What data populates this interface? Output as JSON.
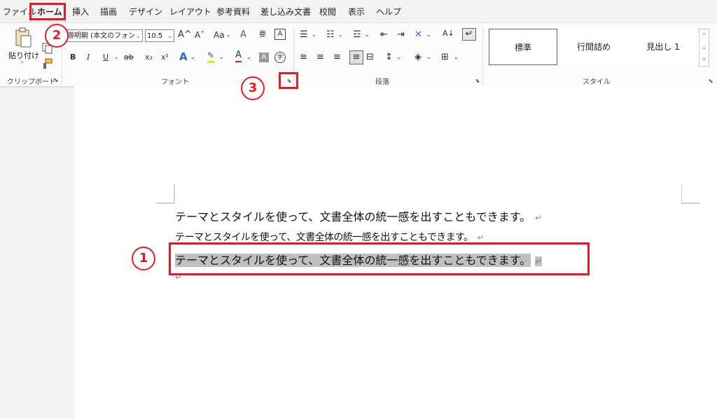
{
  "menu": {
    "tabs": [
      "ファイル",
      "ホーム",
      "挿入",
      "描画",
      "デザイン",
      "レイアウト",
      "参考資料",
      "差し込み文書",
      "校閲",
      "表示",
      "ヘルプ"
    ],
    "active_tab": "ホーム"
  },
  "clipboard": {
    "paste_label": "貼り付け",
    "group_label": "クリップボード"
  },
  "font": {
    "font_name": "游明朝 (本文のフォン",
    "font_size": "10.5",
    "group_label": "フォント",
    "bold": "B",
    "italic": "I",
    "underline": "U",
    "strike": "ab",
    "sub": "x₂",
    "sup": "x²",
    "grow": "A^",
    "shrink": "Aˇ",
    "case": "Aa",
    "font_color_letter": "A",
    "char_shade_letter": "A",
    "enclose_letter": "字",
    "char_border_letter": "A",
    "ruby_letter": "亜"
  },
  "paragraph": {
    "group_label": "段落"
  },
  "styles": {
    "group_label": "スタイル",
    "items": [
      "標準",
      "行間詰め",
      "見出し 1"
    ]
  },
  "document": {
    "lines": [
      "テーマとスタイルを使って、文書全体の統一感を出すこともできます。",
      "テーマとスタイルを使って、文書全体の統一感を出すこともできます。",
      "テーマとスタイルを使って、文書全体の統一感を出すこともできます。"
    ],
    "pilcrow": "↵"
  },
  "annotations": {
    "step1": "1",
    "step2": "2",
    "step3": "3"
  },
  "colors": {
    "annotation_red": "#e31b23",
    "selection_gray": "#bfbfbf"
  }
}
